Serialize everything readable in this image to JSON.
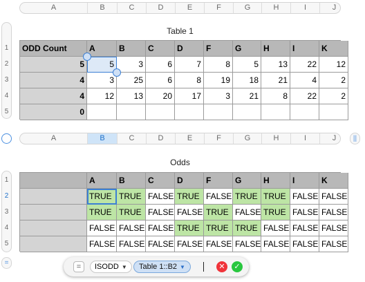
{
  "top_columns": [
    "A",
    "B",
    "C",
    "D",
    "E",
    "F",
    "G",
    "H",
    "I",
    "J"
  ],
  "mid_columns": [
    "A",
    "B",
    "C",
    "D",
    "E",
    "F",
    "G",
    "H",
    "I",
    "J"
  ],
  "selected_column": "B",
  "top_rows": [
    "1",
    "2",
    "3",
    "4",
    "5"
  ],
  "bottom_rows": [
    "1",
    "2",
    "3",
    "4",
    "5"
  ],
  "selected_row": "2",
  "table1": {
    "title": "Table 1",
    "header": [
      "ODD Count",
      "A",
      "B",
      "C",
      "D",
      "F",
      "G",
      "H",
      "I",
      "K"
    ],
    "rows": [
      {
        "label": "5",
        "values": [
          "5",
          "3",
          "6",
          "7",
          "8",
          "5",
          "13",
          "22",
          "12"
        ]
      },
      {
        "label": "4",
        "values": [
          "3",
          "25",
          "6",
          "8",
          "19",
          "18",
          "21",
          "4",
          "2"
        ]
      },
      {
        "label": "4",
        "values": [
          "12",
          "13",
          "20",
          "17",
          "3",
          "21",
          "8",
          "22",
          "2"
        ]
      },
      {
        "label": "0",
        "values": [
          "",
          "",
          "",
          "",
          "",
          "",
          "",
          "",
          ""
        ]
      }
    ]
  },
  "odds": {
    "title": "Odds",
    "header": [
      "",
      "A",
      "B",
      "C",
      "D",
      "F",
      "G",
      "H",
      "I",
      "K"
    ],
    "rows": [
      [
        "TRUE",
        "TRUE",
        "FALSE",
        "TRUE",
        "FALSE",
        "TRUE",
        "TRUE",
        "FALSE",
        "FALSE"
      ],
      [
        "TRUE",
        "TRUE",
        "FALSE",
        "FALSE",
        "TRUE",
        "FALSE",
        "TRUE",
        "FALSE",
        "FALSE"
      ],
      [
        "FALSE",
        "FALSE",
        "FALSE",
        "TRUE",
        "TRUE",
        "TRUE",
        "FALSE",
        "FALSE",
        "FALSE"
      ],
      [
        "FALSE",
        "FALSE",
        "FALSE",
        "FALSE",
        "FALSE",
        "FALSE",
        "FALSE",
        "FALSE",
        "FALSE"
      ]
    ]
  },
  "formula_bar": {
    "equals_glyph": "=",
    "function_name": "ISODD",
    "reference": "Table 1::B2",
    "cancel_glyph": "✕",
    "accept_glyph": "✓"
  },
  "colors": {
    "true_fill": "#bde5a5",
    "header_fill": "#b8b8b8",
    "row_header_fill": "#d4d4d4",
    "selection_blue": "#3b7fd4"
  }
}
